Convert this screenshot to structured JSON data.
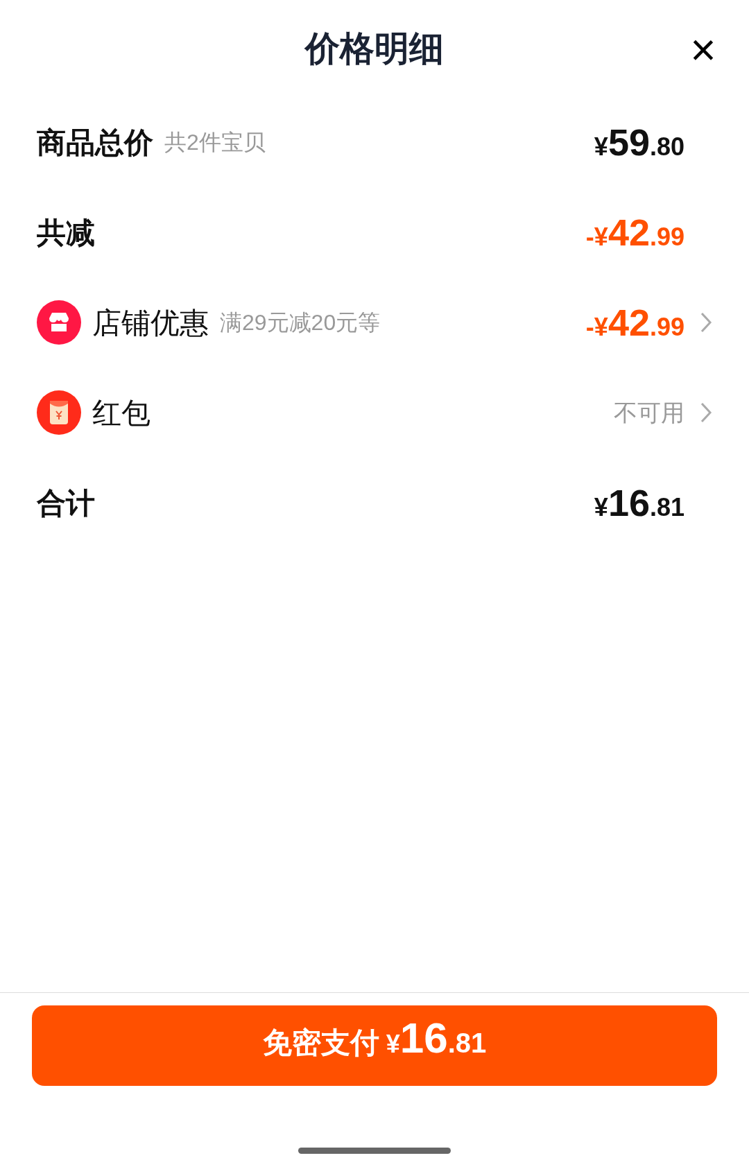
{
  "header": {
    "title": "价格明细",
    "close": "×"
  },
  "rows": [
    {
      "kind": "summary",
      "label": "商品总价",
      "note": "共2件宝贝",
      "price": {
        "currency": "¥",
        "main": "59",
        "fraction": ".80"
      },
      "negative": false
    },
    {
      "kind": "summary",
      "label": "共减",
      "price": {
        "sign": "-",
        "currency": "¥",
        "main": "42",
        "fraction": ".99"
      },
      "negative": true
    },
    {
      "kind": "store",
      "label": "店铺优惠",
      "note": "满29元减20元等",
      "price": {
        "sign": "-",
        "currency": "¥",
        "main": "42",
        "fraction": ".99"
      },
      "negative": true
    },
    {
      "kind": "packet",
      "label": "红包",
      "status": "不可用"
    },
    {
      "kind": "summary",
      "label": "合计",
      "price": {
        "currency": "¥",
        "main": "16",
        "fraction": ".81"
      },
      "negative": false
    }
  ],
  "pay_button": {
    "label": "免密支付",
    "price": {
      "currency": "¥",
      "main": "16",
      "fraction": ".81"
    }
  }
}
